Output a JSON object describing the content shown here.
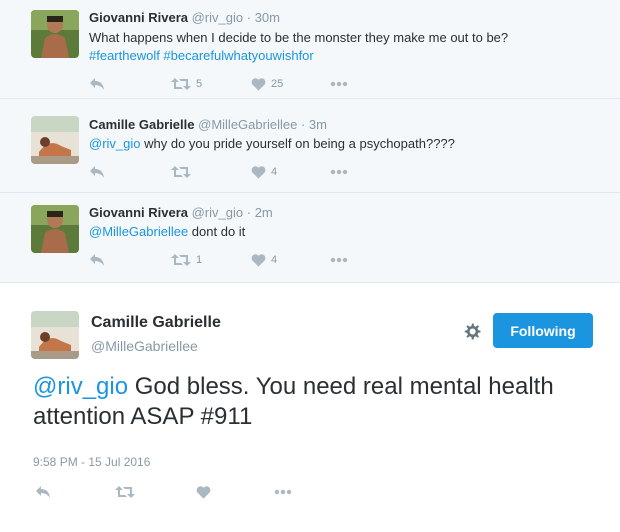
{
  "tweets": [
    {
      "name": "Giovanni Rivera",
      "handle": "@riv_gio",
      "time": "30m",
      "text": "What happens when I decide to be the monster they make me out to be?",
      "hashtags": "#fearthewolf #becarefulwhatyouwishfor",
      "retweets": "5",
      "likes": "25"
    },
    {
      "name": "Camille Gabrielle",
      "handle": "@MilleGabriellee",
      "time": "3m",
      "mention": "@riv_gio",
      "text": " why do you pride yourself on being a psychopath????",
      "retweets": "",
      "likes": "4"
    },
    {
      "name": "Giovanni Rivera",
      "handle": "@riv_gio",
      "time": "2m",
      "mention": "@MilleGabriellee",
      "text": " dont do it",
      "retweets": "1",
      "likes": "4"
    }
  ],
  "separator": "·",
  "expanded": {
    "name": "Camille Gabrielle",
    "handle": "@MilleGabriellee",
    "follow_label": "Following",
    "mention": "@riv_gio",
    "text": " God bless. You need real mental health attention ASAP #911",
    "timestamp": "9:58 PM - 15 Jul 2016"
  },
  "icons": {
    "reply": "reply-icon",
    "retweet": "retweet-icon",
    "like": "heart-icon",
    "more": "more-icon",
    "settings": "gear-icon"
  },
  "colors": {
    "link": "#1b95e0",
    "muted": "#8899a6",
    "action": "#aab8c2",
    "background": "#f5f8fa"
  }
}
